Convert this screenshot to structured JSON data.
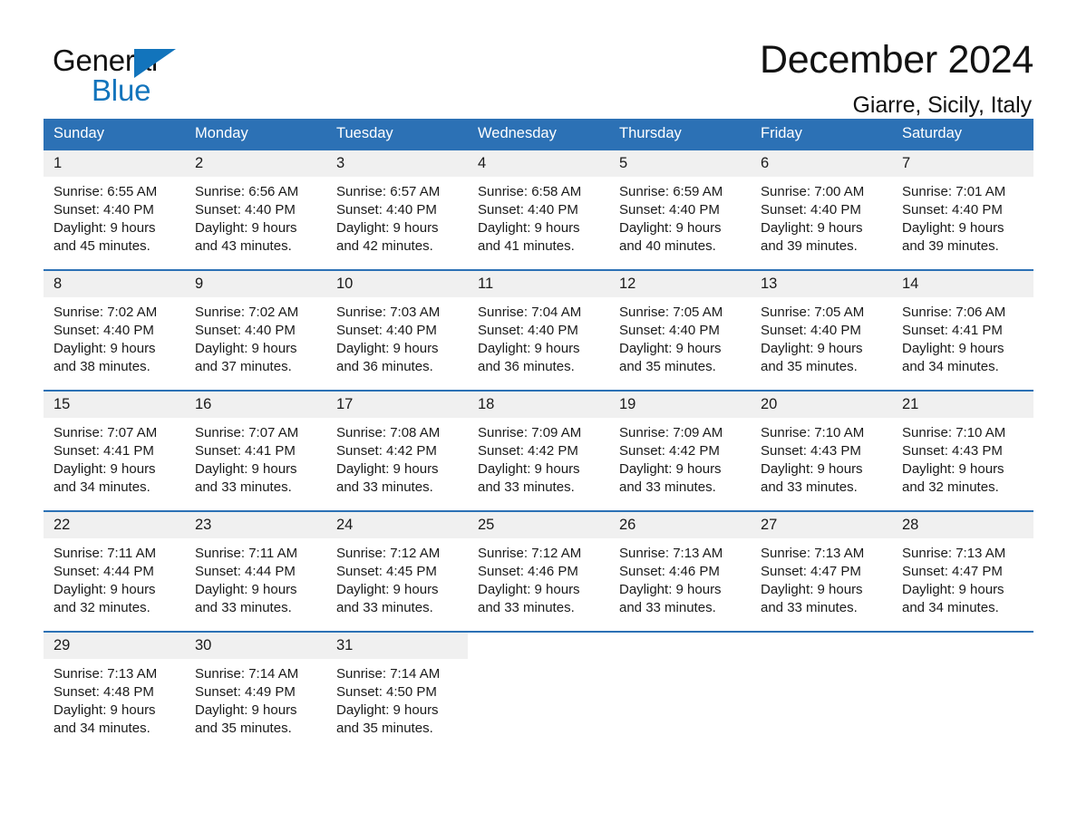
{
  "brand": {
    "name_part1": "General",
    "name_part2": "Blue",
    "triangle_color": "#1274bc"
  },
  "header": {
    "title": "December 2024",
    "location": "Giarre, Sicily, Italy"
  },
  "theme": {
    "header_blue": "#2c71b5",
    "daynum_band": "#f0f0f0",
    "text": "#1a1a1a",
    "brand_blue": "#1274bc"
  },
  "weekdays": [
    "Sunday",
    "Monday",
    "Tuesday",
    "Wednesday",
    "Thursday",
    "Friday",
    "Saturday"
  ],
  "weeks": [
    [
      {
        "day": "1",
        "info": "Sunrise: 6:55 AM\nSunset: 4:40 PM\nDaylight: 9 hours\nand 45 minutes."
      },
      {
        "day": "2",
        "info": "Sunrise: 6:56 AM\nSunset: 4:40 PM\nDaylight: 9 hours\nand 43 minutes."
      },
      {
        "day": "3",
        "info": "Sunrise: 6:57 AM\nSunset: 4:40 PM\nDaylight: 9 hours\nand 42 minutes."
      },
      {
        "day": "4",
        "info": "Sunrise: 6:58 AM\nSunset: 4:40 PM\nDaylight: 9 hours\nand 41 minutes."
      },
      {
        "day": "5",
        "info": "Sunrise: 6:59 AM\nSunset: 4:40 PM\nDaylight: 9 hours\nand 40 minutes."
      },
      {
        "day": "6",
        "info": "Sunrise: 7:00 AM\nSunset: 4:40 PM\nDaylight: 9 hours\nand 39 minutes."
      },
      {
        "day": "7",
        "info": "Sunrise: 7:01 AM\nSunset: 4:40 PM\nDaylight: 9 hours\nand 39 minutes."
      }
    ],
    [
      {
        "day": "8",
        "info": "Sunrise: 7:02 AM\nSunset: 4:40 PM\nDaylight: 9 hours\nand 38 minutes."
      },
      {
        "day": "9",
        "info": "Sunrise: 7:02 AM\nSunset: 4:40 PM\nDaylight: 9 hours\nand 37 minutes."
      },
      {
        "day": "10",
        "info": "Sunrise: 7:03 AM\nSunset: 4:40 PM\nDaylight: 9 hours\nand 36 minutes."
      },
      {
        "day": "11",
        "info": "Sunrise: 7:04 AM\nSunset: 4:40 PM\nDaylight: 9 hours\nand 36 minutes."
      },
      {
        "day": "12",
        "info": "Sunrise: 7:05 AM\nSunset: 4:40 PM\nDaylight: 9 hours\nand 35 minutes."
      },
      {
        "day": "13",
        "info": "Sunrise: 7:05 AM\nSunset: 4:40 PM\nDaylight: 9 hours\nand 35 minutes."
      },
      {
        "day": "14",
        "info": "Sunrise: 7:06 AM\nSunset: 4:41 PM\nDaylight: 9 hours\nand 34 minutes."
      }
    ],
    [
      {
        "day": "15",
        "info": "Sunrise: 7:07 AM\nSunset: 4:41 PM\nDaylight: 9 hours\nand 34 minutes."
      },
      {
        "day": "16",
        "info": "Sunrise: 7:07 AM\nSunset: 4:41 PM\nDaylight: 9 hours\nand 33 minutes."
      },
      {
        "day": "17",
        "info": "Sunrise: 7:08 AM\nSunset: 4:42 PM\nDaylight: 9 hours\nand 33 minutes."
      },
      {
        "day": "18",
        "info": "Sunrise: 7:09 AM\nSunset: 4:42 PM\nDaylight: 9 hours\nand 33 minutes."
      },
      {
        "day": "19",
        "info": "Sunrise: 7:09 AM\nSunset: 4:42 PM\nDaylight: 9 hours\nand 33 minutes."
      },
      {
        "day": "20",
        "info": "Sunrise: 7:10 AM\nSunset: 4:43 PM\nDaylight: 9 hours\nand 33 minutes."
      },
      {
        "day": "21",
        "info": "Sunrise: 7:10 AM\nSunset: 4:43 PM\nDaylight: 9 hours\nand 32 minutes."
      }
    ],
    [
      {
        "day": "22",
        "info": "Sunrise: 7:11 AM\nSunset: 4:44 PM\nDaylight: 9 hours\nand 32 minutes."
      },
      {
        "day": "23",
        "info": "Sunrise: 7:11 AM\nSunset: 4:44 PM\nDaylight: 9 hours\nand 33 minutes."
      },
      {
        "day": "24",
        "info": "Sunrise: 7:12 AM\nSunset: 4:45 PM\nDaylight: 9 hours\nand 33 minutes."
      },
      {
        "day": "25",
        "info": "Sunrise: 7:12 AM\nSunset: 4:46 PM\nDaylight: 9 hours\nand 33 minutes."
      },
      {
        "day": "26",
        "info": "Sunrise: 7:13 AM\nSunset: 4:46 PM\nDaylight: 9 hours\nand 33 minutes."
      },
      {
        "day": "27",
        "info": "Sunrise: 7:13 AM\nSunset: 4:47 PM\nDaylight: 9 hours\nand 33 minutes."
      },
      {
        "day": "28",
        "info": "Sunrise: 7:13 AM\nSunset: 4:47 PM\nDaylight: 9 hours\nand 34 minutes."
      }
    ],
    [
      {
        "day": "29",
        "info": "Sunrise: 7:13 AM\nSunset: 4:48 PM\nDaylight: 9 hours\nand 34 minutes."
      },
      {
        "day": "30",
        "info": "Sunrise: 7:14 AM\nSunset: 4:49 PM\nDaylight: 9 hours\nand 35 minutes."
      },
      {
        "day": "31",
        "info": "Sunrise: 7:14 AM\nSunset: 4:50 PM\nDaylight: 9 hours\nand 35 minutes."
      },
      {
        "day": "",
        "info": ""
      },
      {
        "day": "",
        "info": ""
      },
      {
        "day": "",
        "info": ""
      },
      {
        "day": "",
        "info": ""
      }
    ]
  ]
}
